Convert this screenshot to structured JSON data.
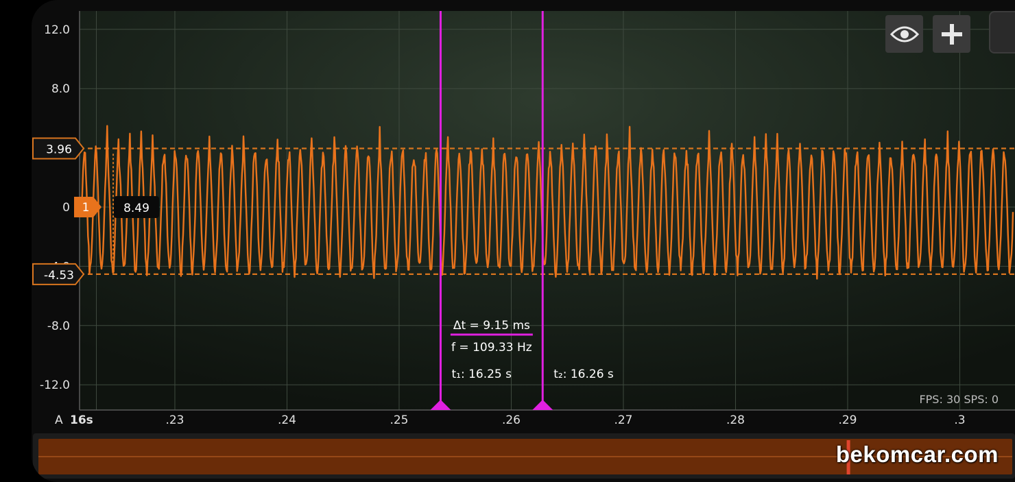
{
  "chart_data": {
    "type": "line",
    "y_ticks": [
      "12.0",
      "8.0",
      "3.96",
      "0",
      "-4.0",
      "-4.53",
      "-8.0",
      "-12.0"
    ],
    "x_ticks": [
      ".23",
      ".24",
      ".25",
      ".26",
      ".27",
      ".28",
      ".29",
      ".3"
    ],
    "x_start_label": "16s",
    "axis_prefix": "A",
    "ylim": [
      -12.0,
      12.0
    ],
    "xlim": [
      16.2215,
      16.3
    ],
    "grid": true,
    "upper_threshold": {
      "label": "3.96",
      "value": 3.96
    },
    "lower_threshold": {
      "label": "-4.53",
      "value": -4.53
    },
    "channel": {
      "label": "1",
      "color": "#e8731c"
    },
    "cursor_readout": {
      "label": "8.49",
      "t": 16.2245
    },
    "signal": {
      "amplitude_low": -4.3,
      "amplitude_high": 3.7,
      "cycles": 82,
      "color": "#e8731c"
    },
    "measurement": {
      "delta_t": "Δt = 9.15 ms",
      "frequency": "f = 109.33 Hz",
      "t1": "t₁: 16.25 s",
      "t2": "t₂: 16.26 s",
      "t1_value": 16.2537,
      "t2_value": 16.2628,
      "color": "#e020e0"
    },
    "stats": "FPS: 30  SPS: 0"
  },
  "toolbar": {
    "eye": "eye-icon",
    "add": "plus-icon"
  },
  "overview": {
    "color": "#6a2c08",
    "position": 0.83
  },
  "watermark": "bekomcar.com"
}
